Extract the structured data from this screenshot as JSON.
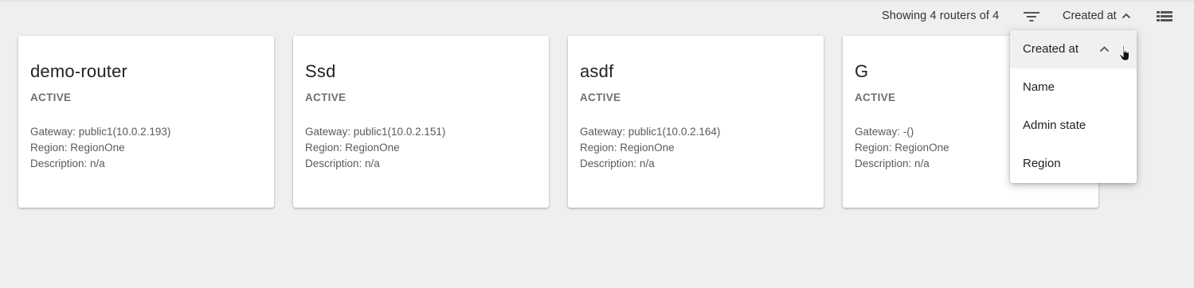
{
  "toolbar": {
    "showing_text": "Showing 4 routers of 4",
    "filter_icon": "filter-icon",
    "sort_label": "Created at",
    "sort_icon": "chevron-up-icon",
    "view_icon": "list-view-icon"
  },
  "routers": [
    {
      "name": "demo-router",
      "status": "ACTIVE",
      "gateway": "Gateway: public1(10.0.2.193)",
      "region": "Region: RegionOne",
      "description": "Description: n/a"
    },
    {
      "name": "Ssd",
      "status": "ACTIVE",
      "gateway": "Gateway: public1(10.0.2.151)",
      "region": "Region: RegionOne",
      "description": "Description: n/a"
    },
    {
      "name": "asdf",
      "status": "ACTIVE",
      "gateway": "Gateway: public1(10.0.2.164)",
      "region": "Region: RegionOne",
      "description": "Description: n/a"
    },
    {
      "name": "G",
      "status": "ACTIVE",
      "gateway": "Gateway: -()",
      "region": "Region: RegionOne",
      "description": "Description: n/a"
    }
  ],
  "sort_menu": {
    "items": [
      {
        "label": "Created at",
        "selected": true
      },
      {
        "label": "Name",
        "selected": false
      },
      {
        "label": "Admin state",
        "selected": false
      },
      {
        "label": "Region",
        "selected": false
      }
    ]
  },
  "colors": {
    "background": "#efefef",
    "card": "#ffffff",
    "status_text": "#707070",
    "menu_active": "#f0f0f0"
  }
}
